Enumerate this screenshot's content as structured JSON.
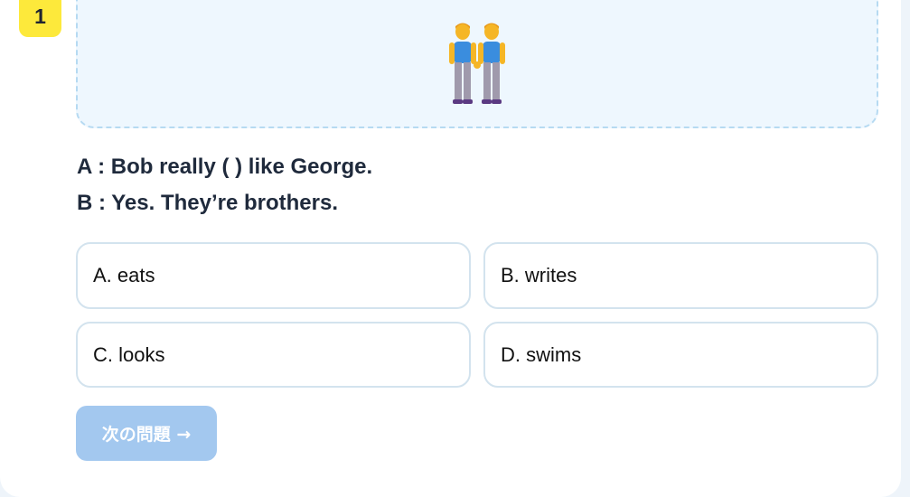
{
  "question": {
    "number": "1",
    "illustration_icon": "two-men-holding-hands-icon",
    "dialog": [
      "A : Bob really ( ) like George.",
      "B : Yes. They’re brothers."
    ]
  },
  "options": [
    {
      "label": "A. eats"
    },
    {
      "label": "B. writes"
    },
    {
      "label": "C. looks"
    },
    {
      "label": "D. swims"
    }
  ],
  "next_button": {
    "label": "次の問題 →",
    "enabled": false
  },
  "colors": {
    "badge": "#fde93b",
    "picture_bg": "#eef7fe",
    "picture_border": "#b6daf2",
    "option_border": "#d3e3ee",
    "next_button_bg": "#a3c8ef",
    "text": "#1f2a3c"
  }
}
